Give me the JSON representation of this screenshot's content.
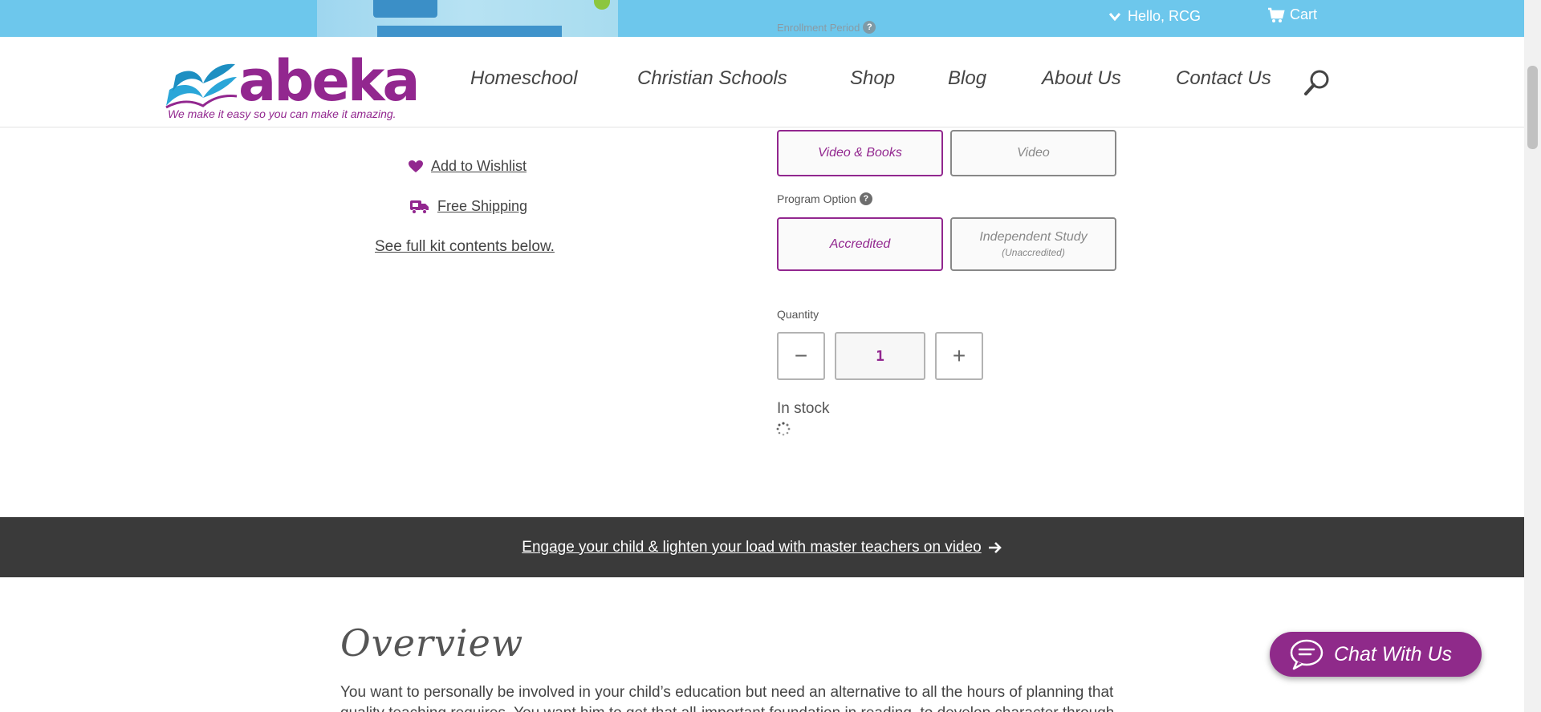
{
  "topbar": {
    "enrollment_label": "Enrollment Period",
    "hello_text": "Hello, RCG",
    "cart_label": "Cart"
  },
  "header": {
    "logo_word": "abeka",
    "logo_reg": "®",
    "tagline": "We make it easy so you can make it amazing.",
    "nav": [
      "Homeschool",
      "Christian Schools",
      "Shop",
      "Blog",
      "About Us",
      "Contact Us"
    ]
  },
  "product": {
    "wishlist_label": "Add to Wishlist",
    "shipping_label": "Free Shipping",
    "kit_link": "See full kit contents below.",
    "format_options": [
      {
        "label": "Video & Books",
        "selected": true
      },
      {
        "label": "Video",
        "selected": false
      }
    ],
    "program_option_label": "Program Option",
    "program_options": [
      {
        "label": "Accredited",
        "sub": "",
        "selected": true
      },
      {
        "label": "Independent Study",
        "sub": "(Unaccredited)",
        "selected": false
      }
    ],
    "quantity_label": "Quantity",
    "quantity_value": "1",
    "decrement": "−",
    "increment": "+",
    "stock_status": "In stock"
  },
  "promo": {
    "text": "Engage your child & lighten your load with master teachers on video "
  },
  "overview": {
    "title": "Overview",
    "text": "You want to personally be involved in your child’s education but need an alternative to all the hours of planning that quality teaching requires. You want him to get that all-important foundation in reading, to develop character through"
  },
  "chat": {
    "label": "Chat With Us"
  },
  "colors": {
    "brand_purple": "#92278f",
    "topbar_blue": "#6dc7ec",
    "banner_dark": "#3a3a3a",
    "logo_blue": "#2aa6d8"
  },
  "icons": [
    "chevron-down-icon",
    "cart-icon",
    "search-icon",
    "heart-icon",
    "truck-icon",
    "help-icon",
    "spinner-icon",
    "arrow-right-icon",
    "chat-bubble-icon"
  ]
}
